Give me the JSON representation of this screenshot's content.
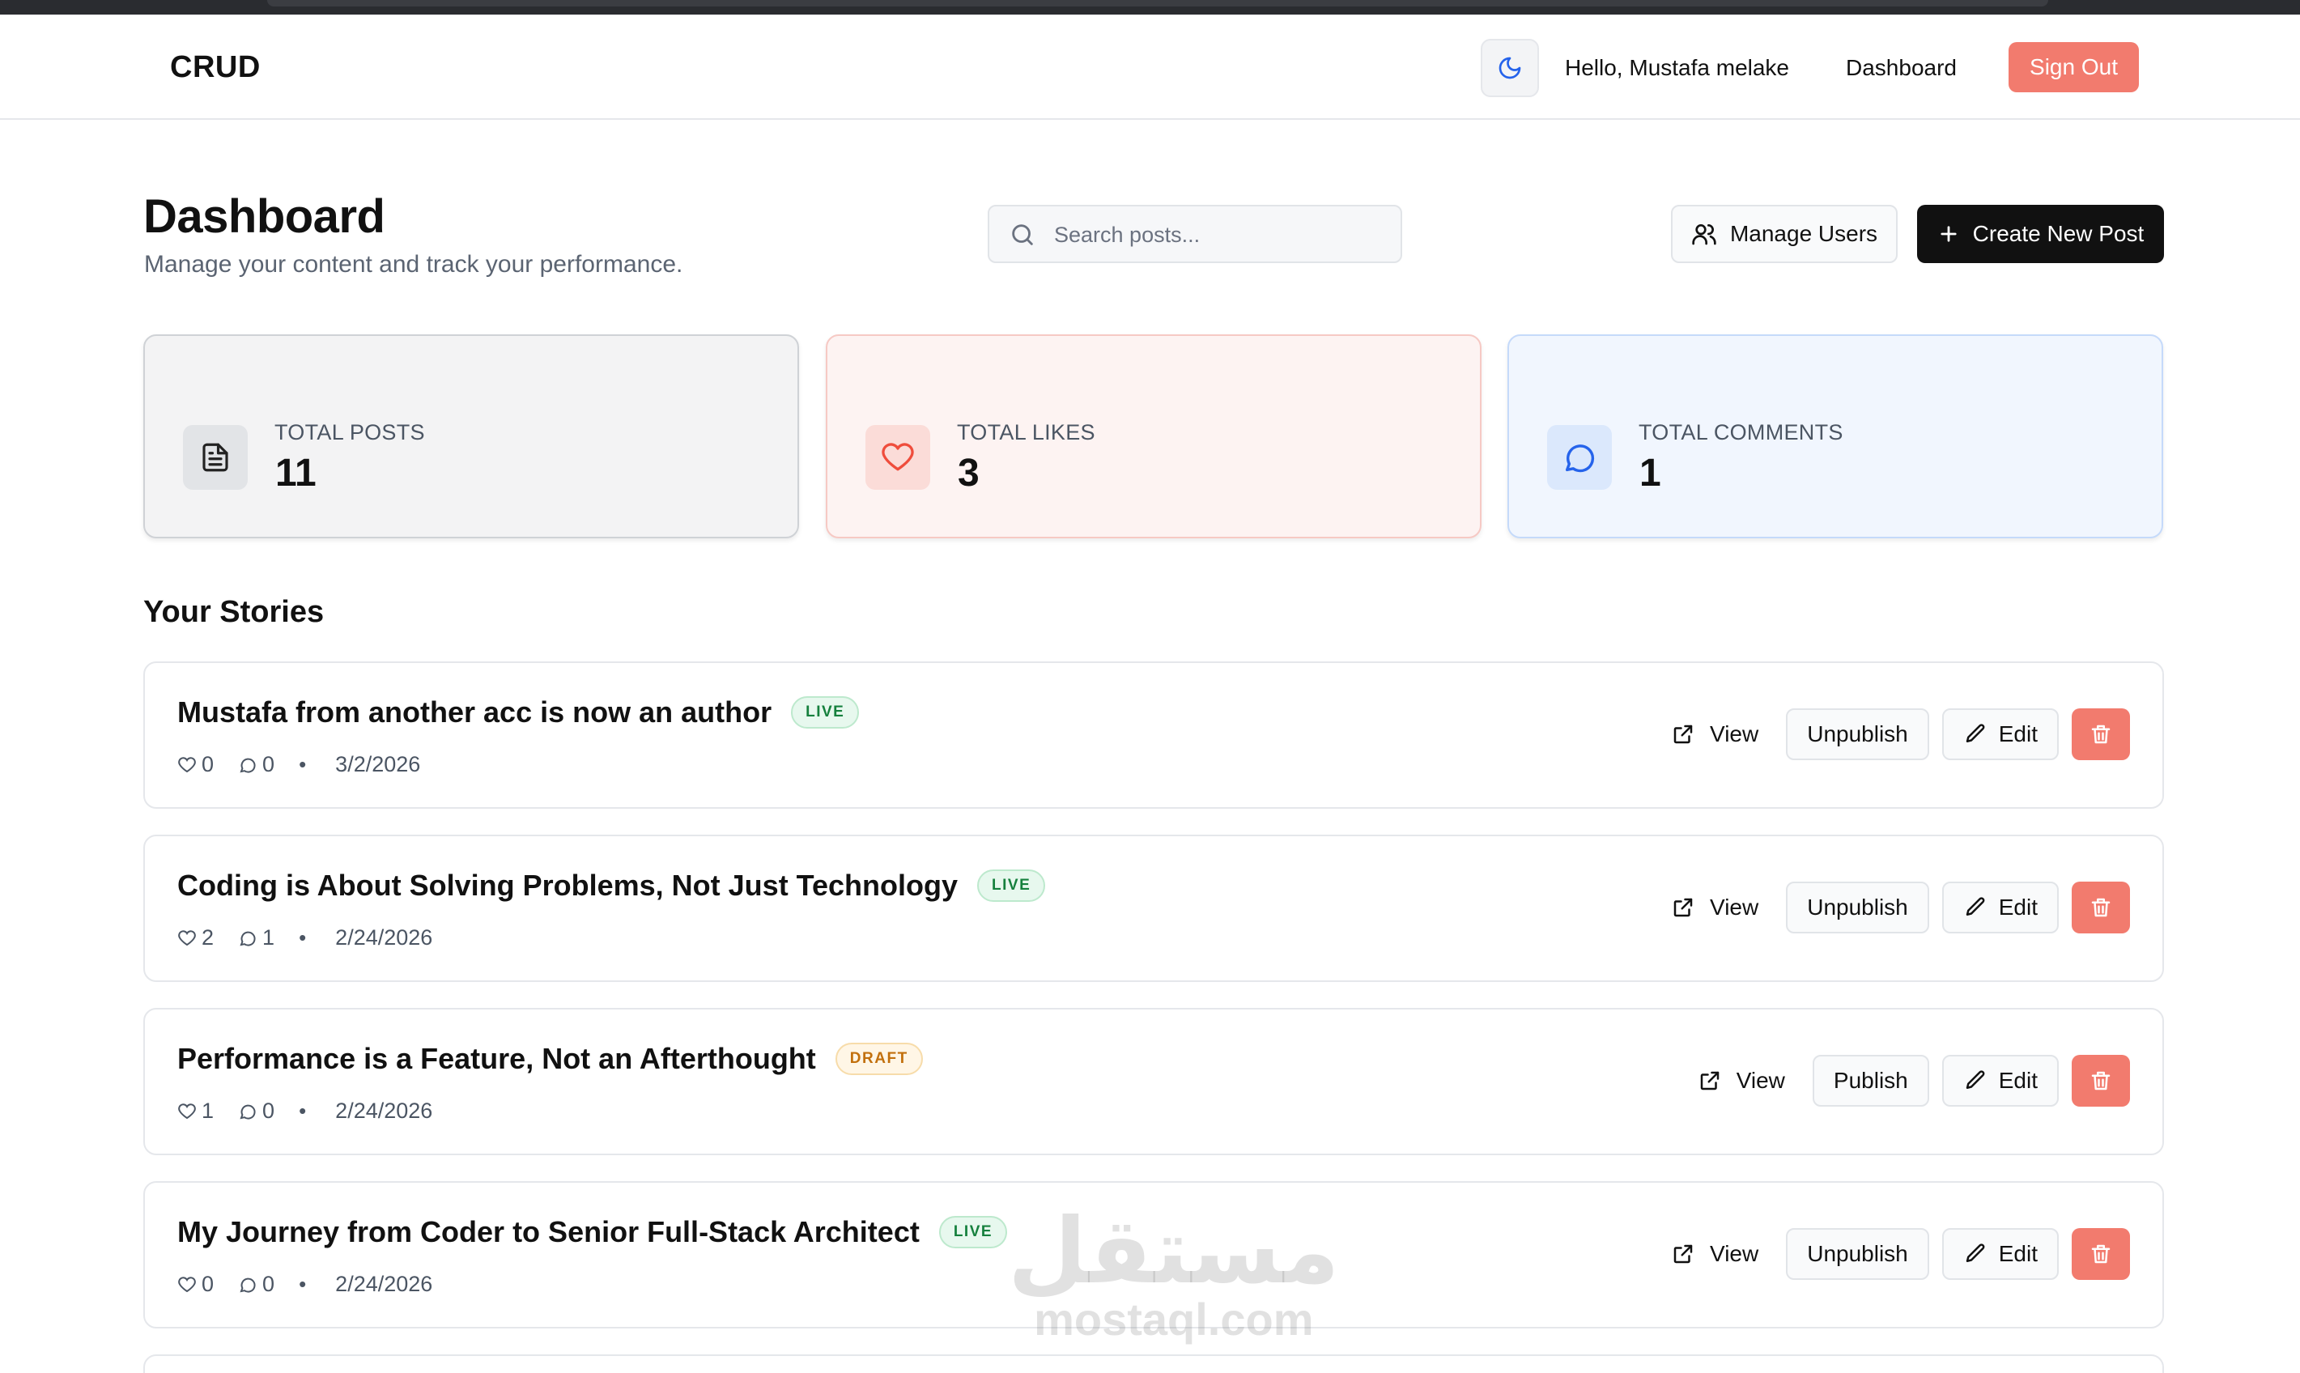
{
  "brand": "CRUD",
  "nav": {
    "theme_icon": "moon-icon",
    "greeting": "Hello, Mustafa melake",
    "dashboard_link": "Dashboard",
    "signout_label": "Sign Out"
  },
  "header": {
    "title": "Dashboard",
    "subtitle": "Manage your content and track your performance.",
    "search_placeholder": "Search posts...",
    "manage_users_label": "Manage Users",
    "create_post_label": "Create New Post"
  },
  "stats": [
    {
      "label": "TOTAL POSTS",
      "value": "11",
      "icon": "document-icon"
    },
    {
      "label": "TOTAL LIKES",
      "value": "3",
      "icon": "heart-icon"
    },
    {
      "label": "TOTAL COMMENTS",
      "value": "1",
      "icon": "comment-icon"
    }
  ],
  "section_title": "Your Stories",
  "posts": [
    {
      "title": "Mustafa from another acc is now an author",
      "status": "LIVE",
      "likes": "0",
      "comments": "0",
      "date": "3/2/2026",
      "toggle_label": "Unpublish"
    },
    {
      "title": "Coding is About Solving Problems, Not Just Technology",
      "status": "LIVE",
      "likes": "2",
      "comments": "1",
      "date": "2/24/2026",
      "toggle_label": "Unpublish"
    },
    {
      "title": "Performance is a Feature, Not an Afterthought",
      "status": "DRAFT",
      "likes": "1",
      "comments": "0",
      "date": "2/24/2026",
      "toggle_label": "Publish"
    },
    {
      "title": "My Journey from Coder to Senior Full-Stack Architect",
      "status": "LIVE",
      "likes": "0",
      "comments": "0",
      "date": "2/24/2026",
      "toggle_label": "Unpublish"
    }
  ],
  "post_actions": {
    "view_label": "View",
    "edit_label": "Edit",
    "meta_separator": "•"
  },
  "watermark": {
    "arabic": "مستقل",
    "latin": "mostaql.com"
  },
  "colors": {
    "accent_red": "#f27b6e",
    "primary_dark": "#111111",
    "live_green": "#15803d",
    "draft_orange": "#c2700d",
    "comment_blue": "#2563eb"
  }
}
